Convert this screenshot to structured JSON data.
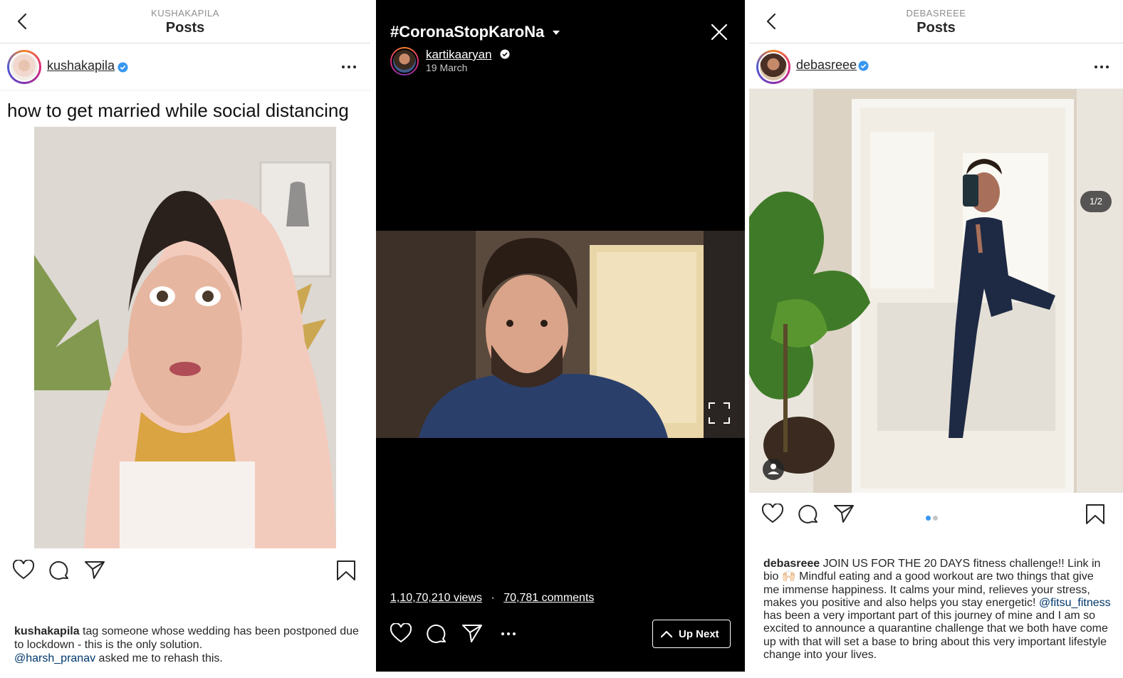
{
  "panel_left": {
    "header": {
      "username": "KUSHAKAPILA",
      "title": "Posts"
    },
    "user": {
      "handle": "kushakapila",
      "verified": true
    },
    "post": {
      "title": "how to get married while social distancing"
    },
    "caption": {
      "author": "kushakapila",
      "text": " tag someone whose wedding has been postponed due to lockdown - this is the only solution.",
      "mention": "@harsh_pranav",
      "text2": " asked me to rehash this."
    }
  },
  "panel_center": {
    "hashtag": "#CoronaStopKaroNa",
    "user": {
      "handle": "kartikaaryan",
      "verified": true,
      "date": "19 March"
    },
    "stats": {
      "views": "1,10,70,210 views",
      "separator": "·",
      "comments": "70,781 comments"
    },
    "up_next_label": "Up Next"
  },
  "panel_right": {
    "header": {
      "username": "DEBASREEE",
      "title": "Posts"
    },
    "user": {
      "handle": "debasreee",
      "verified": true
    },
    "carousel": {
      "counter": "1/2",
      "current": 1,
      "total": 2
    },
    "caption": {
      "author": "debasreee",
      "text1": " JOIN US FOR THE 20 DAYS fitness challenge!! Link in bio 🙌🏻 Mindful eating and a good workout are two things that give me immense happiness. It calms your mind, relieves your stress, makes you positive and also helps you stay energetic! ",
      "mention": "@fitsu_fitness",
      "text2": " has been a very important part of this journey of mine and I am so excited to announce a quarantine challenge that we both have come up with that will set a base to bring about this very important lifestyle change into your lives."
    }
  },
  "colors": {
    "link": "#00376b",
    "verified": "#3897f0",
    "dot_active": "#3897f0",
    "dot_inactive": "#c7c7c7"
  },
  "icons": [
    "back-arrow-icon",
    "verified-badge-icon",
    "more-options-icon",
    "heart-icon",
    "comment-icon",
    "share-icon",
    "bookmark-icon",
    "close-icon",
    "fullscreen-icon",
    "chevron-up-icon",
    "dropdown-caret-icon",
    "user-tag-icon"
  ]
}
